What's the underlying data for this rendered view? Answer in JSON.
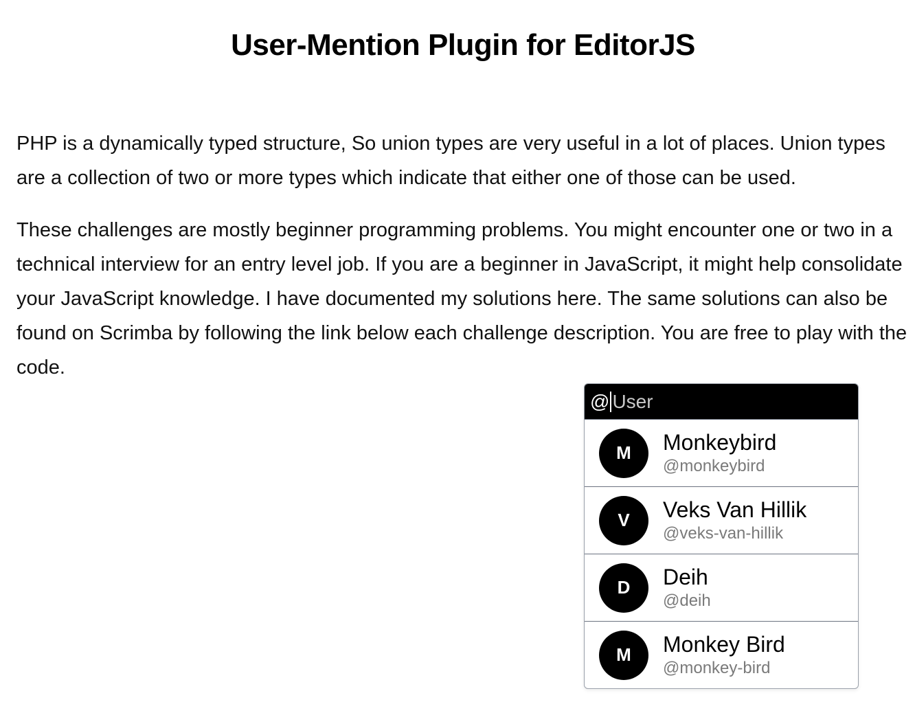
{
  "page": {
    "title": "User-Mention Plugin for EditorJS"
  },
  "editor": {
    "paragraphs": [
      "PHP is a dynamically typed structure, So union types are very useful in a lot of places. Union types are a collection of two or more types which indicate that either one of those can be used.",
      "These challenges are mostly beginner programming problems. You might encounter one or two in a technical interview for an entry level job. If you are a beginner in JavaScript, it might help consolidate your JavaScript knowledge. I have documented my solutions here. The same solutions can also be found on Scrimba by following the link below each challenge description. You are free to play with the code."
    ]
  },
  "mention": {
    "trigger": "@",
    "placeholder": "User",
    "value": "",
    "users": [
      {
        "initial": "M",
        "name": "Monkeybird",
        "handle": "@monkeybird"
      },
      {
        "initial": "V",
        "name": "Veks Van Hillik",
        "handle": "@veks-van-hillik"
      },
      {
        "initial": "D",
        "name": "Deih",
        "handle": "@deih"
      },
      {
        "initial": "M",
        "name": "Monkey Bird",
        "handle": "@monkey-bird"
      }
    ]
  },
  "colors": {
    "popup_header_bg": "#000000",
    "avatar_bg": "#000000",
    "handle_text": "#7a7a7a",
    "divider": "#6b7280"
  }
}
